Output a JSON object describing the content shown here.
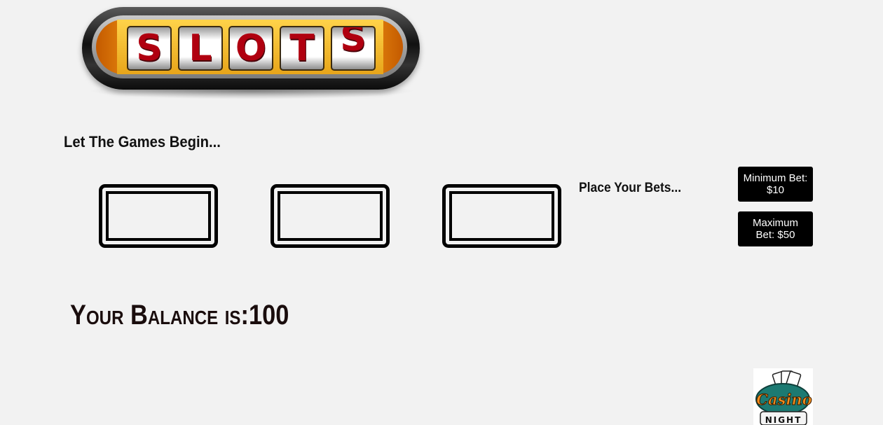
{
  "logo": {
    "letters": [
      "S",
      "L",
      "O",
      "T",
      "S"
    ]
  },
  "intro_text": "Let The Games Begin...",
  "reels": [
    "",
    "",
    ""
  ],
  "place_bets_text": "Place Your Bets...",
  "buttons": {
    "min_bet": "Minimum Bet: $10",
    "max_bet": "Maximum Bet: $50"
  },
  "balance": {
    "label": "Your Balance is:",
    "value": "100"
  },
  "casino_logo": {
    "word1": "Casino",
    "word2": "NIGHT"
  },
  "colors": {
    "background": "#f2f2f2",
    "button_bg": "#000000",
    "button_text": "#ffffff",
    "reel_letter": "#b00010",
    "logo_orange": "#e88a10",
    "logo_gold": "#ffd34a"
  },
  "icons": {
    "logo": "slots-reel-logo",
    "casino": "casino-night-logo"
  }
}
